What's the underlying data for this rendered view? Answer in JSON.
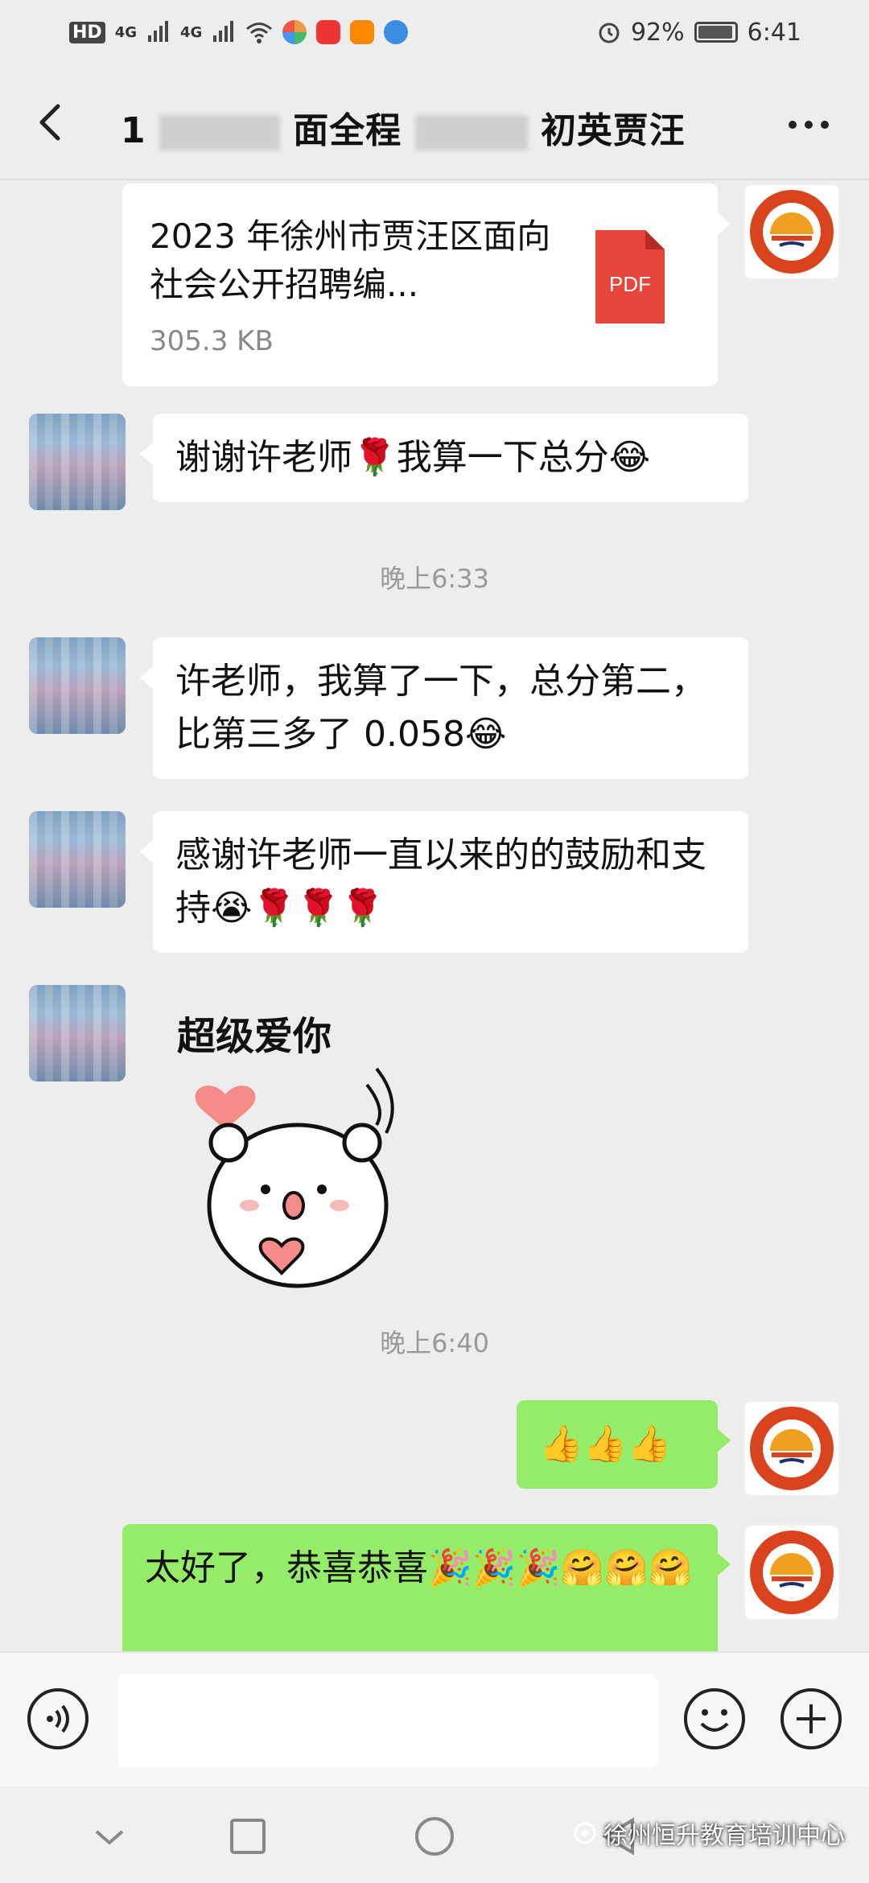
{
  "status_bar": {
    "hd_label": "HD",
    "sig1": "4G",
    "sig2": "4G",
    "battery_percent": "92%",
    "time": "6:41"
  },
  "title_bar": {
    "title_start": "1",
    "title_mid1": "面全程",
    "title_mid2": "初英贾汪"
  },
  "messages": {
    "file": {
      "name": "2023 年徐州市贾汪区面向社会公开招聘编...",
      "size": "305.3 KB",
      "type_label": "PDF"
    },
    "peer1": "谢谢许老师🌹我算一下总分😂",
    "time1": "晚上6:33",
    "peer2": "许老师，我算了一下，总分第二，比第三多了 0.058😂",
    "peer3": "感谢许老师一直以来的的鼓励和支持😭🌹🌹🌹",
    "sticker_text": "超级爱你",
    "time2": "晚上6:40",
    "self1": "👍👍👍",
    "self2": "太好了，恭喜恭喜🎉🎉🎉🤗🤗🤗"
  },
  "watermark": "徐州恒升教育培训中心",
  "colors": {
    "bubble_self": "#95ec69",
    "bubble_peer": "#ffffff",
    "background": "#ededed",
    "pdf_red": "#e8453c",
    "logo_red": "#d9431e"
  }
}
